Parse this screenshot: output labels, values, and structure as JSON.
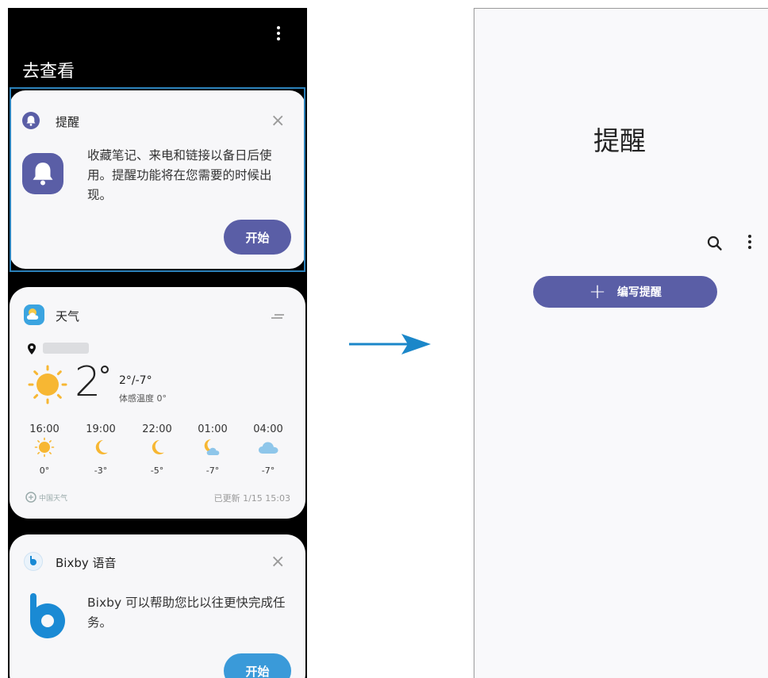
{
  "left_screen": {
    "header_title": "去查看",
    "reminder_card": {
      "title": "提醒",
      "body": "收藏笔记、来电和链接以备日后使用。提醒功能将在您需要的时候出现。",
      "start_label": "开始",
      "close_glyph": "×"
    },
    "weather_card": {
      "title": "天气",
      "location": "",
      "current_temp": "2",
      "degree_symbol": "°",
      "high_low": "2°/-7°",
      "feels_like": "体感温度 0°",
      "forecast": [
        {
          "time": "16:00",
          "icon": "sun-icon",
          "temp": "0°"
        },
        {
          "time": "19:00",
          "icon": "moon-icon",
          "temp": "-3°"
        },
        {
          "time": "22:00",
          "icon": "moon-icon",
          "temp": "-5°"
        },
        {
          "time": "01:00",
          "icon": "moon-cloud-icon",
          "temp": "-7°"
        },
        {
          "time": "04:00",
          "icon": "cloud-icon",
          "temp": "-7°"
        }
      ],
      "provider": "中国天气",
      "updated": "已更新 1/15 15:03"
    },
    "bixby_card": {
      "title": "Bixby 语音",
      "body": "Bixby 可以帮助您比以往更快完成任务。",
      "start_label": "开始",
      "close_glyph": "×"
    }
  },
  "right_screen": {
    "title": "提醒",
    "compose_label": "编写提醒",
    "compose_icon": "+"
  },
  "colors": {
    "accent": "#5a5ea6",
    "bixby_blue": "#1a8ad4",
    "sun": "#f7b733",
    "highlight": "#2a80b9",
    "arrow": "#1b87c9"
  }
}
